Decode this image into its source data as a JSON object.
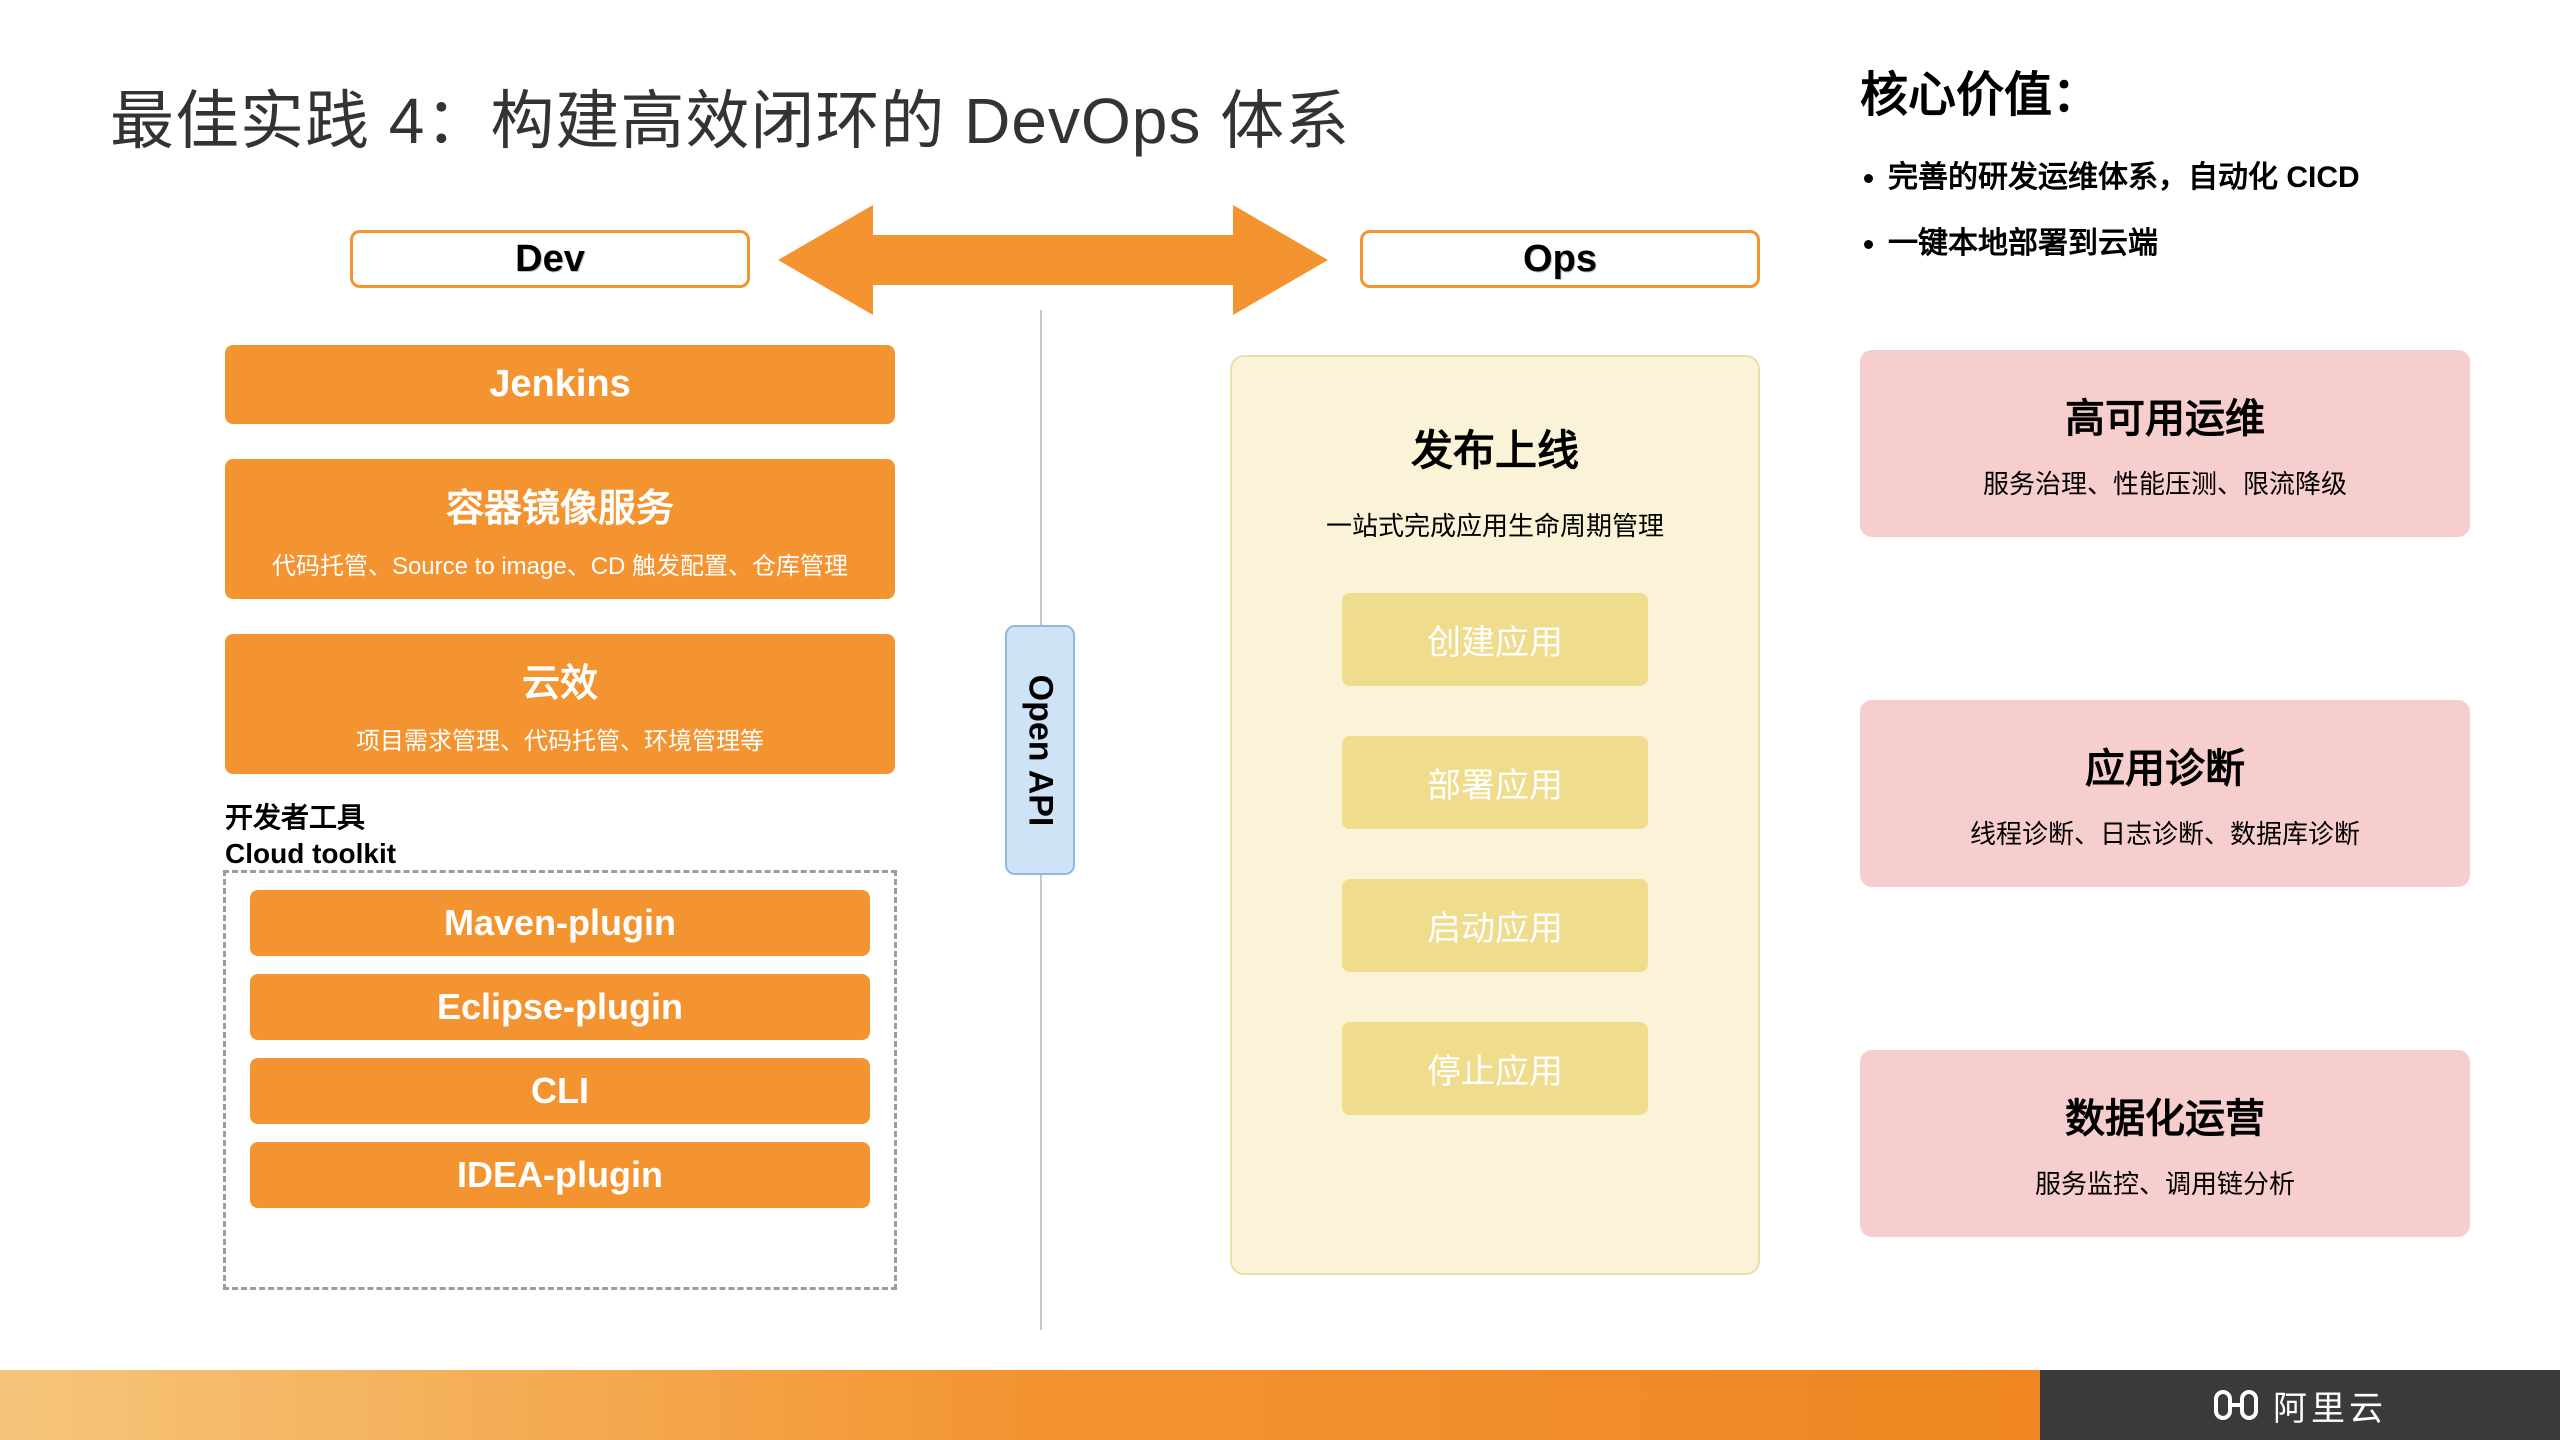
{
  "title": "最佳实践 4：构建高效闭环的 DevOps 体系",
  "pills": {
    "dev": "Dev",
    "ops": "Ops"
  },
  "dev": {
    "jenkins": "Jenkins",
    "container": {
      "hd": "容器镜像服务",
      "sub": "代码托管、Source to image、CD 触发配置、仓库管理"
    },
    "yunxiao": {
      "hd": "云效",
      "sub": "项目需求管理、代码托管、环境管理等"
    },
    "toolkit_label_line1": "开发者工具",
    "toolkit_label_line2": "Cloud toolkit",
    "plugins": [
      "Maven-plugin",
      "Eclipse-plugin",
      "CLI",
      "IDEA-plugin"
    ]
  },
  "openapi": "Open API",
  "ops": {
    "hd": "发布上线",
    "sub": "一站式完成应用生命周期管理",
    "items": [
      "创建应用",
      "部署应用",
      "启动应用",
      "停止应用"
    ]
  },
  "core": {
    "title": "核心价值：",
    "bullets": [
      "完善的研发运维体系，自动化 CICD",
      "一键本地部署到云端"
    ],
    "cards": [
      {
        "hd": "高可用运维",
        "sub": "服务治理、性能压测、限流降级"
      },
      {
        "hd": "应用诊断",
        "sub": "线程诊断、日志诊断、数据库诊断"
      },
      {
        "hd": "数据化运营",
        "sub": "服务监控、调用链分析"
      }
    ]
  },
  "footer_brand": "阿里云"
}
